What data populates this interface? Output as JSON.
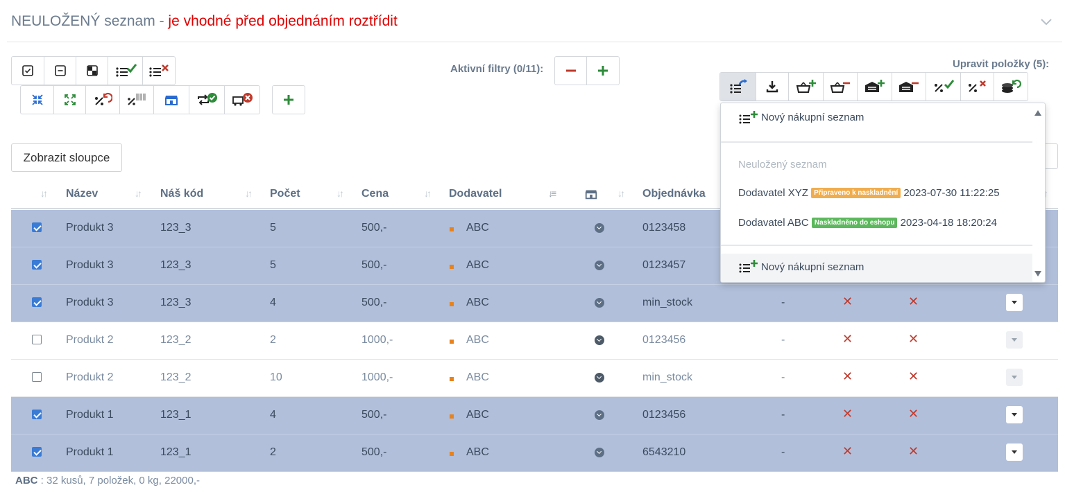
{
  "header": {
    "title_main": "NEULOŽENÝ seznam",
    "title_sep": " - ",
    "title_warning": "je vhodné před objednáním roztřídit"
  },
  "filters": {
    "label": "Aktivní filtry (0/11):"
  },
  "edit": {
    "label": "Upravit položky (5):"
  },
  "columns_button": "Zobrazit sloupce",
  "table": {
    "headers": {
      "name": "Název",
      "code": "Náš kód",
      "count": "Počet",
      "price": "Cena",
      "supplier": "Dodavatel",
      "order": "Objednávka"
    },
    "rows": [
      {
        "selected": true,
        "name": "Produkt 3",
        "code": "123_3",
        "count": "5",
        "price": "500,-",
        "supplier": "ABC",
        "order": "0123458",
        "dash": "-"
      },
      {
        "selected": true,
        "name": "Produkt 3",
        "code": "123_3",
        "count": "5",
        "price": "500,-",
        "supplier": "ABC",
        "order": "0123457",
        "dash": "-"
      },
      {
        "selected": true,
        "name": "Produkt 3",
        "code": "123_3",
        "count": "4",
        "price": "500,-",
        "supplier": "ABC",
        "order": "min_stock",
        "dash": "-"
      },
      {
        "selected": false,
        "name": "Produkt 2",
        "code": "123_2",
        "count": "2",
        "price": "1000,-",
        "supplier": "ABC",
        "order": "0123456",
        "dash": "-"
      },
      {
        "selected": false,
        "name": "Produkt 2",
        "code": "123_2",
        "count": "10",
        "price": "1000,-",
        "supplier": "ABC",
        "order": "min_stock",
        "dash": "-"
      },
      {
        "selected": true,
        "name": "Produkt 1",
        "code": "123_1",
        "count": "4",
        "price": "500,-",
        "supplier": "ABC",
        "order": "0123456",
        "dash": "-"
      },
      {
        "selected": true,
        "name": "Produkt 1",
        "code": "123_1",
        "count": "2",
        "price": "500,-",
        "supplier": "ABC",
        "order": "6543210",
        "dash": "-"
      }
    ]
  },
  "footer": {
    "supplier": "ABC",
    "summary": " : 32 kusů, 7 položek, 0 kg, 22000,-"
  },
  "menu": {
    "new_list": "Nový nákupní seznam",
    "unsaved_header": "Neuložený seznam",
    "lists": [
      {
        "supplier": "Dodavatel XYZ",
        "status": "Připraveno k naskladnění",
        "status_color": "#f0ad4e",
        "date": "2023-07-30 11:22:25"
      },
      {
        "supplier": "Dodavatel ABC",
        "status": "Naskladněno do eshopu",
        "status_color": "#5cb85c",
        "date": "2023-04-18 18:20:24"
      }
    ],
    "new_list_bottom": "Nový nákupní seznam"
  },
  "colors": {
    "selected_row": "#b1bfdb",
    "warning": "#e00000",
    "green": "#2e8b3a",
    "red": "#c0392b"
  }
}
